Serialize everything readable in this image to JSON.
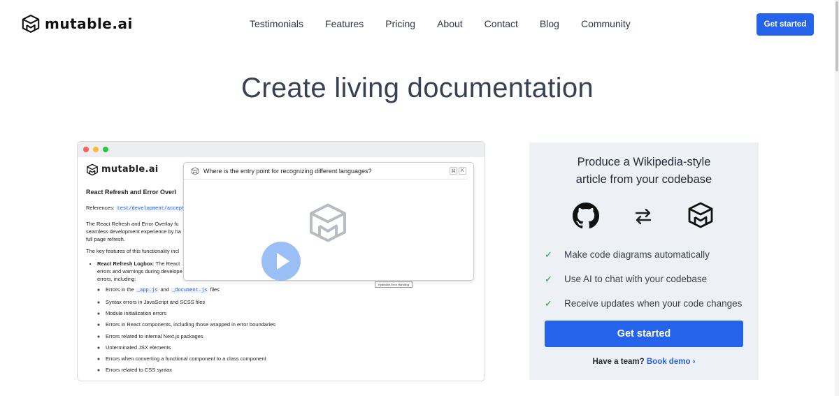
{
  "nav": {
    "logo_text": "mutable.ai",
    "links": [
      "Testimonials",
      "Features",
      "Pricing",
      "About",
      "Contact",
      "Blog",
      "Community"
    ],
    "cta": "Get started"
  },
  "hero": {
    "title": "Create living documentation"
  },
  "demo": {
    "logo_text": "mutable.ai",
    "heading": "React Refresh and Error Overl",
    "ref_label": "References:",
    "ref_code": "test/development/accept",
    "para1_a": "The React Refresh and Error Overlay fu",
    "para1_b": "seamless development experience by ha",
    "para1_c": "full page refresh.",
    "para2": "The key features of this functionality incl",
    "bullet_title": "React Refresh Logbox",
    "bullet_rest_a": ": The React",
    "bullet_rest_b": "errors and warnings during develope",
    "bullet_rest_c": "errors, including:",
    "sub_items": [
      "Syntax errors in JavaScript and SCSS files",
      "Module initialization errors",
      "Errors in React components, including those wrapped in error boundaries",
      "Errors related to internal Next.js packages",
      "Unterminated JSX elements",
      "Errors when converting a functional component to a class component",
      "Errors related to CSS syntax"
    ],
    "errors_in_prefix": "Errors in the",
    "code_app": "_app.js",
    "and": "and",
    "code_document": "_document.js",
    "files": "files",
    "chat_question": "Where is the entry point for recognizing different languages?",
    "chat_key1": "⌘",
    "chat_key2": "K",
    "hydration_label": "Hydration Error Handling"
  },
  "card": {
    "title_line1": "Produce a Wikipedia-style",
    "title_line2": "article from your codebase",
    "features": [
      "Make code diagrams automatically",
      "Use AI to chat with your codebase",
      "Receive updates when your code changes"
    ],
    "cta": "Get started",
    "team_text": "Have a team?",
    "demo_link": "Book demo ›"
  },
  "colors": {
    "accent": "#2563eb",
    "check": "#16a34a",
    "card_bg": "#edf0f4"
  }
}
